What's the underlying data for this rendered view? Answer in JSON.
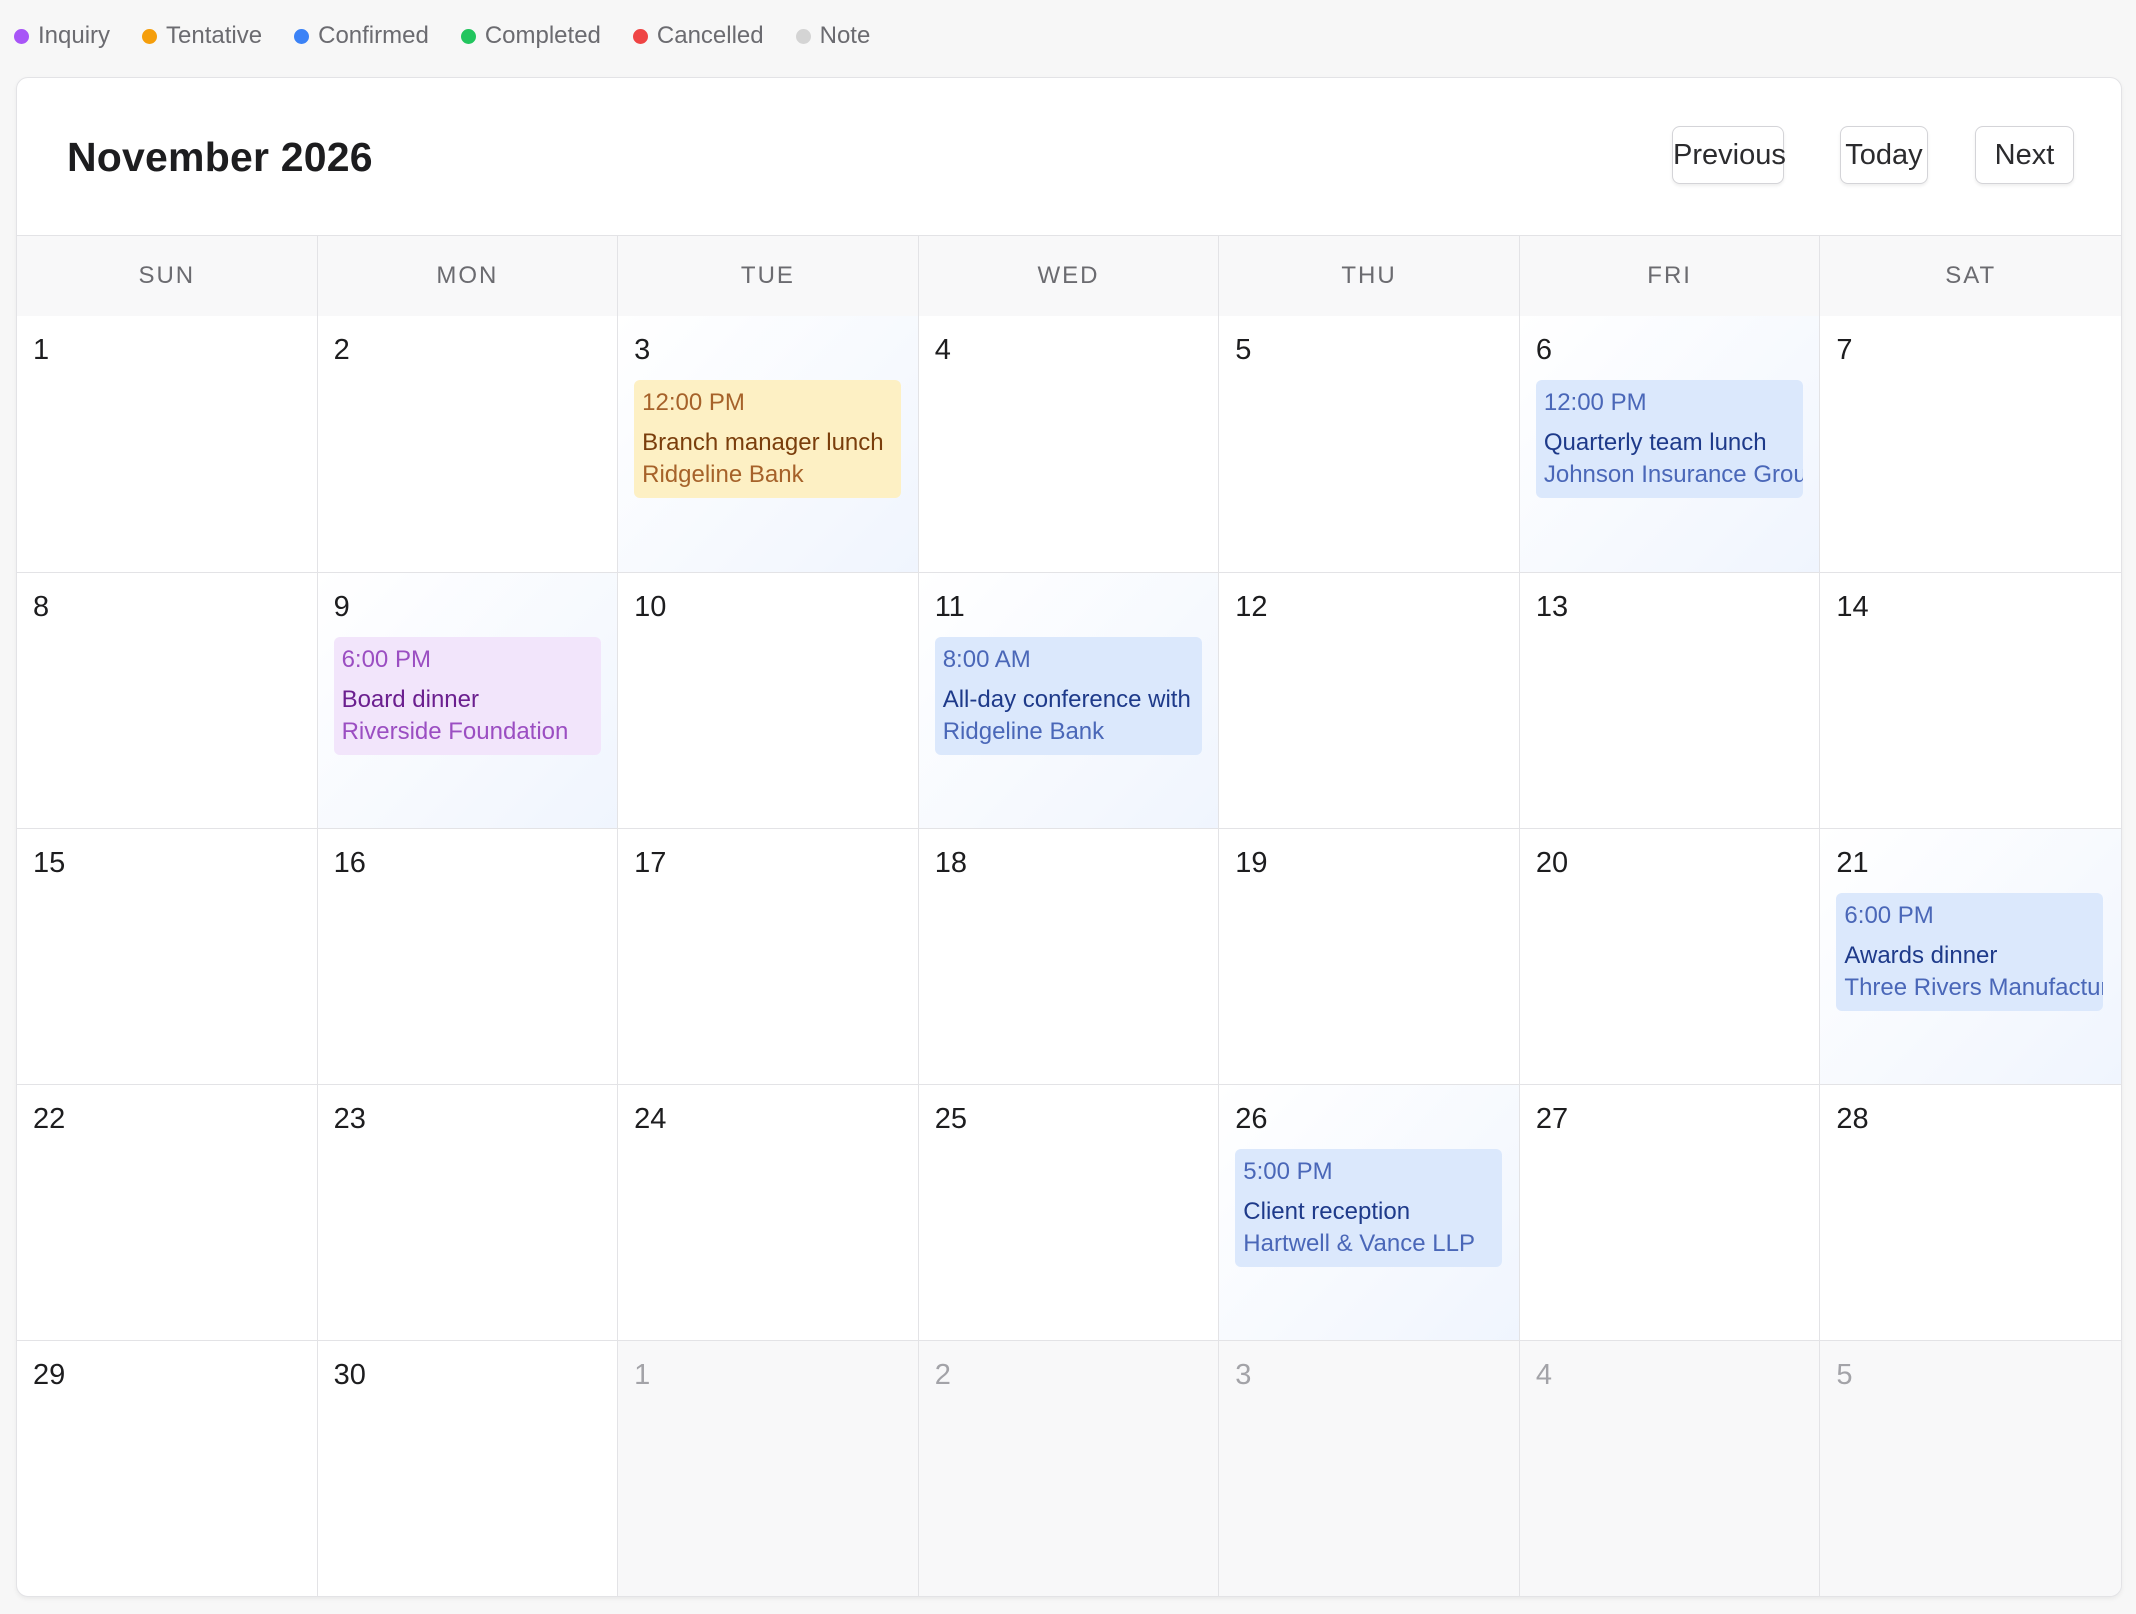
{
  "legend": [
    {
      "label": "Inquiry",
      "color": "#a855f7"
    },
    {
      "label": "Tentative",
      "color": "#f59e0b"
    },
    {
      "label": "Confirmed",
      "color": "#3b82f6"
    },
    {
      "label": "Completed",
      "color": "#22c55e"
    },
    {
      "label": "Cancelled",
      "color": "#ef4444"
    },
    {
      "label": "Note",
      "color": "#d4d4d4"
    }
  ],
  "calendar": {
    "month_title": "November 2026",
    "nav": {
      "previous": "Previous",
      "today": "Today",
      "next": "Next"
    },
    "weekdays": [
      "SUN",
      "MON",
      "TUE",
      "WED",
      "THU",
      "FRI",
      "SAT"
    ],
    "weeks": [
      [
        {
          "day": "1"
        },
        {
          "day": "2"
        },
        {
          "day": "3",
          "event": {
            "status": "tentative",
            "time": "12:00 PM",
            "title": "Branch manager lunch",
            "client": "Ridgeline Bank"
          }
        },
        {
          "day": "4"
        },
        {
          "day": "5"
        },
        {
          "day": "6",
          "event": {
            "status": "confirmed",
            "time": "12:00 PM",
            "title": "Quarterly team lunch",
            "client": "Johnson Insurance Group"
          }
        },
        {
          "day": "7"
        }
      ],
      [
        {
          "day": "8"
        },
        {
          "day": "9",
          "event": {
            "status": "inquiry",
            "time": "6:00 PM",
            "title": "Board dinner",
            "client": "Riverside Foundation"
          }
        },
        {
          "day": "10"
        },
        {
          "day": "11",
          "event": {
            "status": "confirmed",
            "time": "8:00 AM",
            "title": "All-day conference with",
            "client": "Ridgeline Bank"
          }
        },
        {
          "day": "12"
        },
        {
          "day": "13"
        },
        {
          "day": "14"
        }
      ],
      [
        {
          "day": "15"
        },
        {
          "day": "16"
        },
        {
          "day": "17"
        },
        {
          "day": "18"
        },
        {
          "day": "19"
        },
        {
          "day": "20"
        },
        {
          "day": "21",
          "event": {
            "status": "confirmed",
            "time": "6:00 PM",
            "title": "Awards dinner",
            "client": "Three Rivers Manufacturing"
          }
        }
      ],
      [
        {
          "day": "22"
        },
        {
          "day": "23"
        },
        {
          "day": "24"
        },
        {
          "day": "25"
        },
        {
          "day": "26",
          "event": {
            "status": "confirmed",
            "time": "5:00 PM",
            "title": "Client reception",
            "client": "Hartwell & Vance LLP"
          }
        },
        {
          "day": "27"
        },
        {
          "day": "28"
        }
      ],
      [
        {
          "day": "29"
        },
        {
          "day": "30"
        },
        {
          "day": "1",
          "other_month": true
        },
        {
          "day": "2",
          "other_month": true
        },
        {
          "day": "3",
          "other_month": true
        },
        {
          "day": "4",
          "other_month": true
        },
        {
          "day": "5",
          "other_month": true
        }
      ]
    ]
  }
}
